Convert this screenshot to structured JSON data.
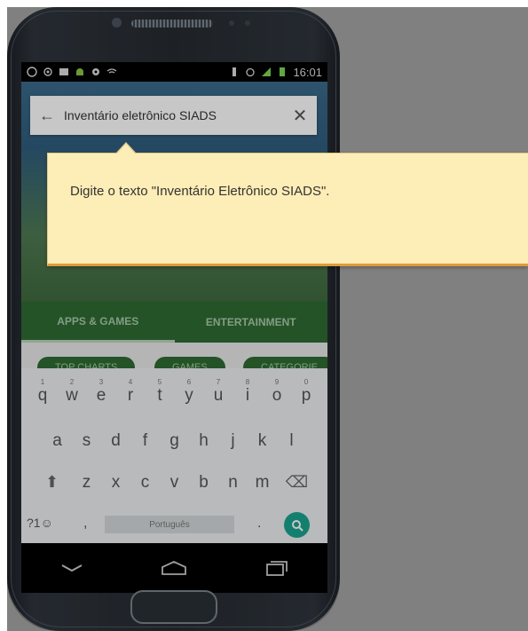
{
  "search": {
    "query": "Inventário eletrônico SIADS"
  },
  "statusbar": {
    "time": "16:01"
  },
  "tabs": [
    {
      "label": "APPS & GAMES"
    },
    {
      "label": "ENTERTAINMENT"
    }
  ],
  "chips": [
    {
      "label": "TOP CHARTS"
    },
    {
      "label": "GAMES"
    },
    {
      "label": "CATEGORIE"
    }
  ],
  "keyboard": {
    "row1": [
      {
        "k": "q",
        "n": "1"
      },
      {
        "k": "w",
        "n": "2"
      },
      {
        "k": "e",
        "n": "3"
      },
      {
        "k": "r",
        "n": "4"
      },
      {
        "k": "t",
        "n": "5"
      },
      {
        "k": "y",
        "n": "6"
      },
      {
        "k": "u",
        "n": "7"
      },
      {
        "k": "i",
        "n": "8"
      },
      {
        "k": "o",
        "n": "9"
      },
      {
        "k": "p",
        "n": "0"
      }
    ],
    "row2": [
      "a",
      "s",
      "d",
      "f",
      "g",
      "h",
      "j",
      "k",
      "l"
    ],
    "row3": [
      "z",
      "x",
      "c",
      "v",
      "b",
      "n",
      "m"
    ],
    "emoji_key": "?1☺",
    "comma": ",",
    "space_label": "Português",
    "period": "."
  },
  "tooltip": {
    "text": "Digite o texto \"Inventário Eletrônico SIADS\"."
  },
  "colors": {
    "tooltip_bg": "#fdedb6",
    "tooltip_border": "#e09a3a",
    "accent_green": "#2e6b33",
    "go_key": "#1aa38e"
  }
}
